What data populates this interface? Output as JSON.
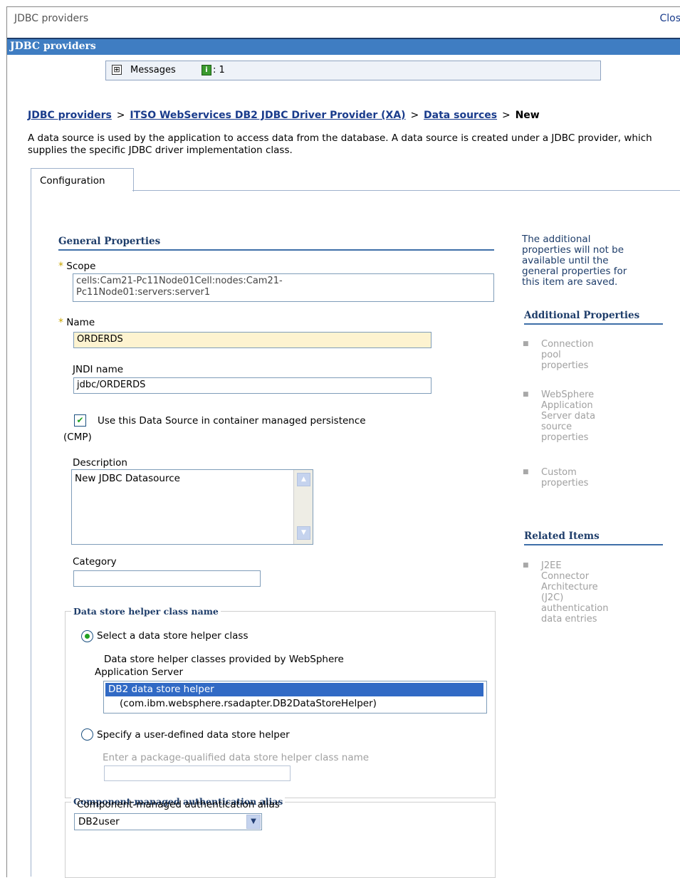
{
  "window": {
    "title": "JDBC providers",
    "close_label": "Clos"
  },
  "panel": {
    "title": "JDBC providers"
  },
  "messages": {
    "expand_glyph": "⊞",
    "label": "Messages",
    "info_glyph": "i",
    "count": ": 1"
  },
  "breadcrumb": {
    "items": [
      "JDBC providers",
      "ITSO WebServices DB2 JDBC Driver Provider (XA)",
      "Data sources"
    ],
    "separator": ">",
    "current": "New"
  },
  "description": "A data source is used by the application to access data from the database. A data source is created under a JDBC provider, which supplies the specific JDBC driver implementation class.",
  "tabs": [
    {
      "label": "Configuration"
    }
  ],
  "general": {
    "title": "General Properties",
    "required_mark": "*",
    "scope_label": "Scope",
    "scope_value_line1": "cells:Cam21-Pc11Node01Cell:nodes:Cam21-",
    "scope_value_line2": "Pc11Node01:servers:server1",
    "name_label": "Name",
    "name_value": "ORDERDS",
    "jndi_label": "JNDI name",
    "jndi_value": "jdbc/ORDERDS",
    "cmp_check": "✔",
    "cmp_label_line1": "Use this Data Source in container managed persistence",
    "cmp_label_line2": "(CMP)",
    "description_label": "Description",
    "description_value": "New JDBC Datasource",
    "category_label": "Category",
    "category_value": ""
  },
  "helper": {
    "legend": "Data store helper class name",
    "option_select": "Select a data store helper class",
    "provided_label_line1": "Data store helper classes provided by WebSphere",
    "provided_label_line2": "Application Server",
    "list_selected": "DB2 data store helper",
    "list_sub": "(com.ibm.websphere.rsadapter.DB2DataStoreHelper)",
    "option_custom": "Specify a user-defined data store helper",
    "custom_hint": "Enter a package-qualified data store helper class name",
    "custom_value": ""
  },
  "auth": {
    "legend": "Component-managed authentication alias",
    "label": "Component-managed authentication alias",
    "selected": "DB2user"
  },
  "side": {
    "note": [
      "The additional",
      "properties will not be",
      "available until the",
      "general properties for",
      "this item are saved."
    ],
    "additional_title": "Additional Properties",
    "additional_items": [
      [
        "Connection",
        "pool",
        "properties"
      ],
      [
        "WebSphere",
        "Application",
        "Server data",
        "source",
        "properties"
      ],
      [
        "Custom",
        "properties"
      ]
    ],
    "related_title": "Related Items",
    "related_items": [
      [
        "J2EE",
        "Connector",
        "Architecture",
        "(J2C)",
        "authentication",
        "data entries"
      ]
    ],
    "bullet": "■"
  }
}
